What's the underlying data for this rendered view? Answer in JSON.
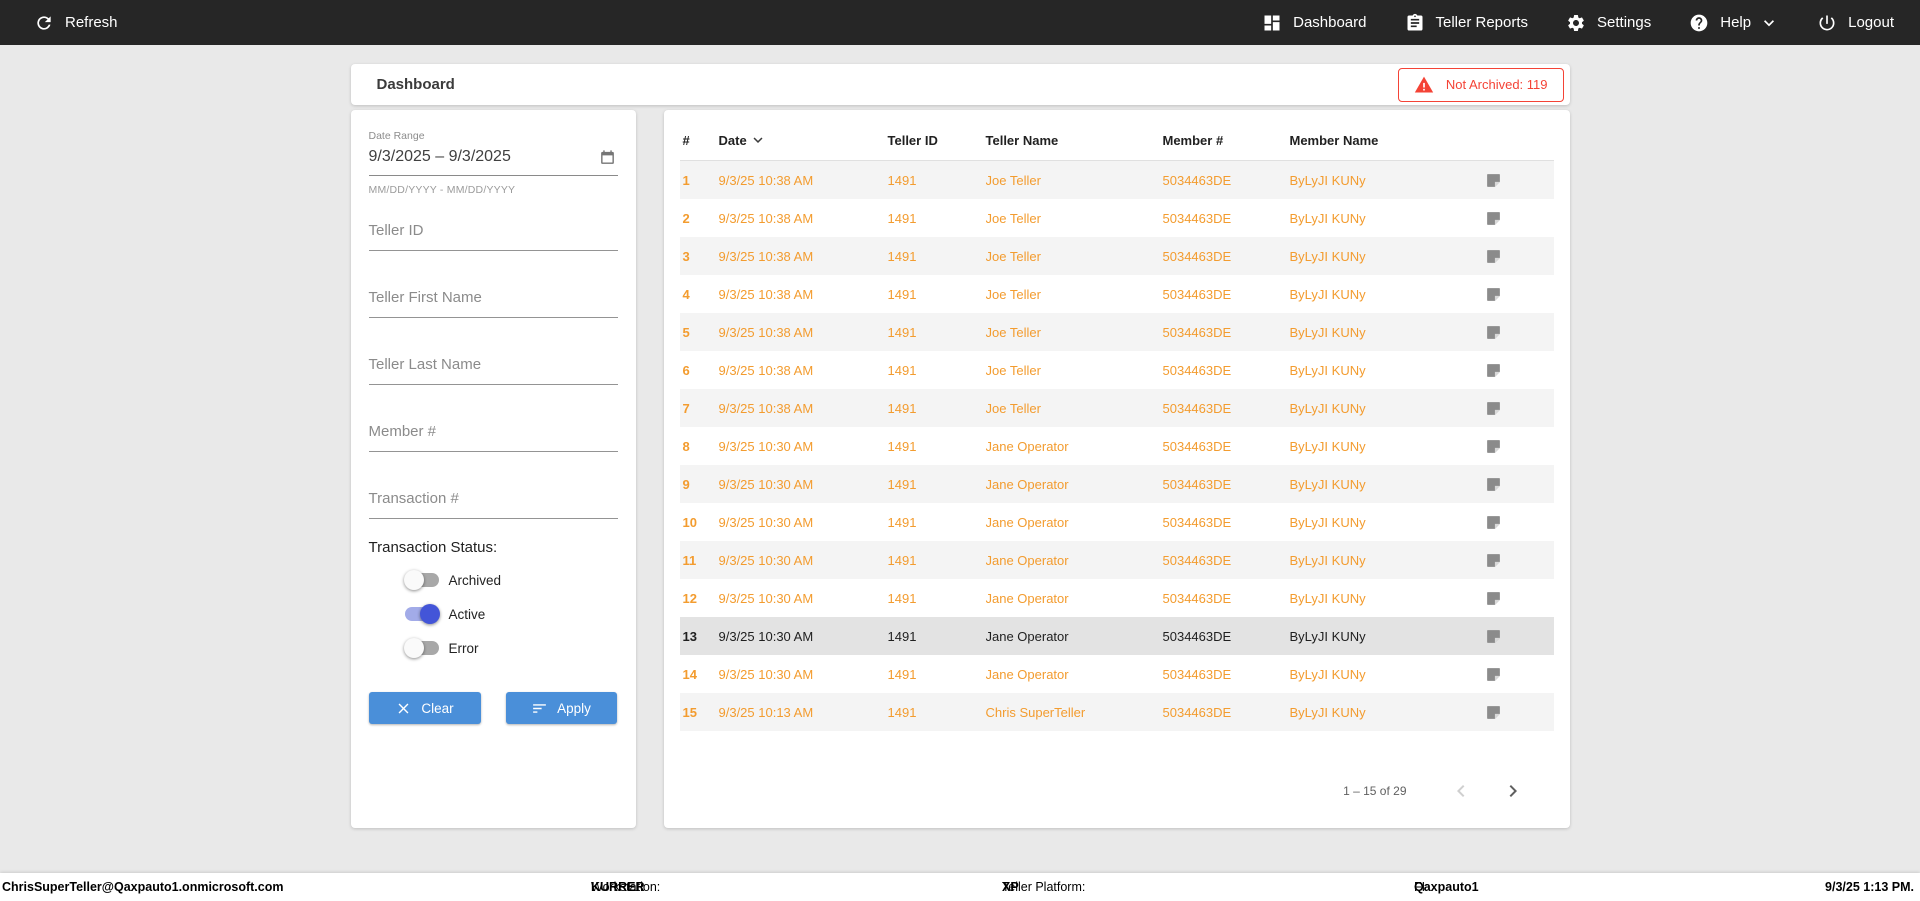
{
  "topbar": {
    "refresh_label": "Refresh",
    "nav": [
      {
        "label": "Dashboard",
        "icon": "dashboard-icon"
      },
      {
        "label": "Teller Reports",
        "icon": "reports-icon"
      },
      {
        "label": "Settings",
        "icon": "settings-icon"
      },
      {
        "label": "Help",
        "icon": "help-icon"
      },
      {
        "label": "Logout",
        "icon": "logout-icon"
      }
    ]
  },
  "header": {
    "title": "Dashboard",
    "badge_label": "Not Archived: 119"
  },
  "filters": {
    "date_range": {
      "label": "Date Range",
      "value": "9/3/2025 – 9/3/2025",
      "hint": "MM/DD/YYYY - MM/DD/YYYY"
    },
    "inputs": [
      {
        "placeholder": "Teller ID"
      },
      {
        "placeholder": "Teller First Name"
      },
      {
        "placeholder": "Teller Last Name"
      },
      {
        "placeholder": "Member #"
      },
      {
        "placeholder": "Transaction #"
      }
    ],
    "status": {
      "label": "Transaction Status:",
      "toggles": [
        {
          "label": "Archived",
          "on": false
        },
        {
          "label": "Active",
          "on": true
        },
        {
          "label": "Error",
          "on": false
        }
      ]
    },
    "clear_label": "Clear",
    "apply_label": "Apply"
  },
  "table": {
    "columns": [
      "#",
      "Date",
      "Teller ID",
      "Teller Name",
      "Member #",
      "Member Name"
    ],
    "sorted_by": "Date",
    "rows": [
      {
        "num": "1",
        "date": "9/3/25 10:38 AM",
        "teller_id": "1491",
        "teller_name": "Joe Teller",
        "member_number": "5034463DE",
        "member_name": "ByLyJI KUNy",
        "selected": false
      },
      {
        "num": "2",
        "date": "9/3/25 10:38 AM",
        "teller_id": "1491",
        "teller_name": "Joe Teller",
        "member_number": "5034463DE",
        "member_name": "ByLyJI KUNy",
        "selected": false
      },
      {
        "num": "3",
        "date": "9/3/25 10:38 AM",
        "teller_id": "1491",
        "teller_name": "Joe Teller",
        "member_number": "5034463DE",
        "member_name": "ByLyJI KUNy",
        "selected": false
      },
      {
        "num": "4",
        "date": "9/3/25 10:38 AM",
        "teller_id": "1491",
        "teller_name": "Joe Teller",
        "member_number": "5034463DE",
        "member_name": "ByLyJI KUNy",
        "selected": false
      },
      {
        "num": "5",
        "date": "9/3/25 10:38 AM",
        "teller_id": "1491",
        "teller_name": "Joe Teller",
        "member_number": "5034463DE",
        "member_name": "ByLyJI KUNy",
        "selected": false
      },
      {
        "num": "6",
        "date": "9/3/25 10:38 AM",
        "teller_id": "1491",
        "teller_name": "Joe Teller",
        "member_number": "5034463DE",
        "member_name": "ByLyJI KUNy",
        "selected": false
      },
      {
        "num": "7",
        "date": "9/3/25 10:38 AM",
        "teller_id": "1491",
        "teller_name": "Joe Teller",
        "member_number": "5034463DE",
        "member_name": "ByLyJI KUNy",
        "selected": false
      },
      {
        "num": "8",
        "date": "9/3/25 10:30 AM",
        "teller_id": "1491",
        "teller_name": "Jane Operator",
        "member_number": "5034463DE",
        "member_name": "ByLyJI KUNy",
        "selected": false
      },
      {
        "num": "9",
        "date": "9/3/25 10:30 AM",
        "teller_id": "1491",
        "teller_name": "Jane Operator",
        "member_number": "5034463DE",
        "member_name": "ByLyJI KUNy",
        "selected": false
      },
      {
        "num": "10",
        "date": "9/3/25 10:30 AM",
        "teller_id": "1491",
        "teller_name": "Jane Operator",
        "member_number": "5034463DE",
        "member_name": "ByLyJI KUNy",
        "selected": false
      },
      {
        "num": "11",
        "date": "9/3/25 10:30 AM",
        "teller_id": "1491",
        "teller_name": "Jane Operator",
        "member_number": "5034463DE",
        "member_name": "ByLyJI KUNy",
        "selected": false
      },
      {
        "num": "12",
        "date": "9/3/25 10:30 AM",
        "teller_id": "1491",
        "teller_name": "Jane Operator",
        "member_number": "5034463DE",
        "member_name": "ByLyJI KUNy",
        "selected": false
      },
      {
        "num": "13",
        "date": "9/3/25 10:30 AM",
        "teller_id": "1491",
        "teller_name": "Jane Operator",
        "member_number": "5034463DE",
        "member_name": "ByLyJI KUNy",
        "selected": true
      },
      {
        "num": "14",
        "date": "9/3/25 10:30 AM",
        "teller_id": "1491",
        "teller_name": "Jane Operator",
        "member_number": "5034463DE",
        "member_name": "ByLyJI KUNy",
        "selected": false
      },
      {
        "num": "15",
        "date": "9/3/25 10:13 AM",
        "teller_id": "1491",
        "teller_name": "Chris SuperTeller",
        "member_number": "5034463DE",
        "member_name": "ByLyJI KUNy",
        "selected": false
      }
    ],
    "pagination": {
      "range_label": "1 – 15 of 29"
    }
  },
  "footer": {
    "user_email": "ChrisSuperTeller@Qaxpauto1.onmicrosoft.com",
    "workstation_label": "Workstation:",
    "workstation_value": "KURRER",
    "platform_label": "Teller Platform:",
    "platform_value": "XP",
    "fi_label": "FI:",
    "fi_value": "Qaxpauto1",
    "timestamp": "9/3/25 1:13 PM."
  },
  "colors": {
    "topbar_bg": "#262626",
    "accent_blue": "#4a8fd9",
    "toggle_on_blue": "#4355d8",
    "row_orange": "#f39c2f",
    "alert_red": "#f44336"
  }
}
